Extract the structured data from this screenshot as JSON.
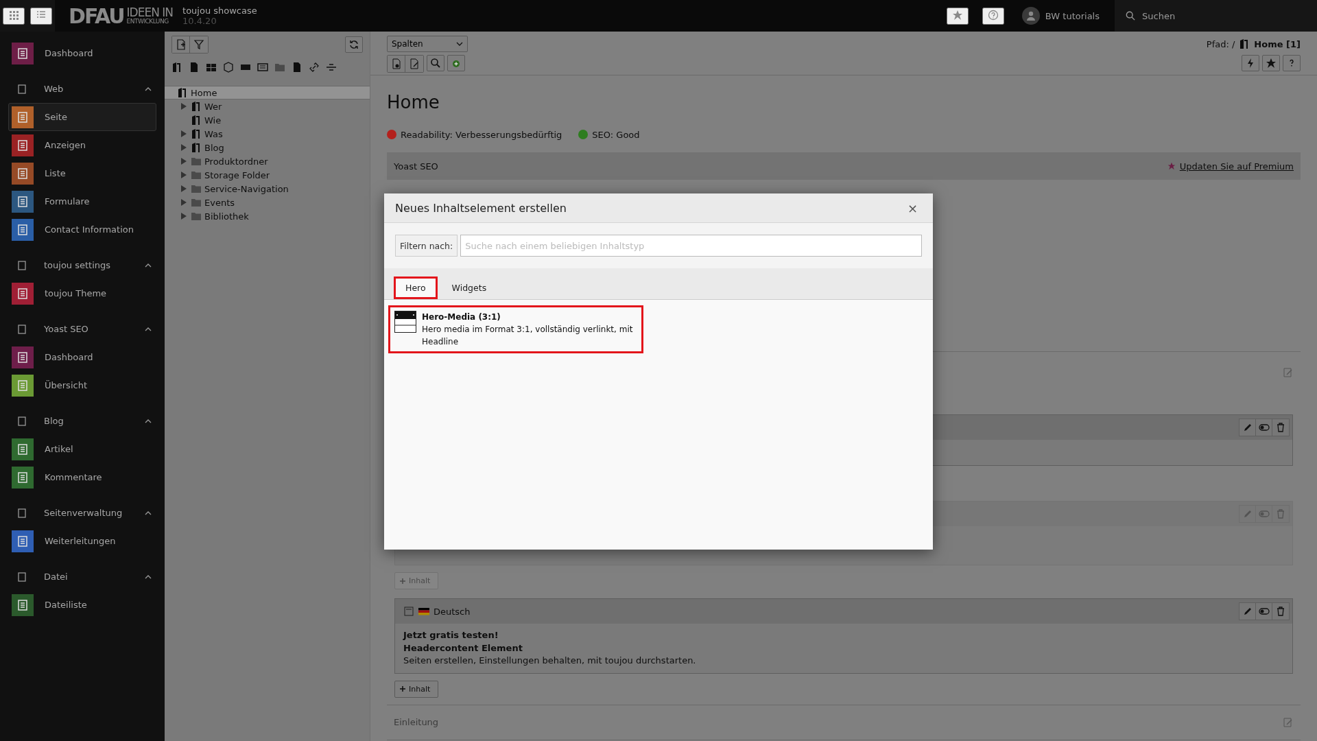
{
  "topbar": {
    "logo_main": "DFAU",
    "logo_top": "IDEEN IN",
    "logo_bottom": "ENTWICKLUNG",
    "site_name": "toujou showcase",
    "version": "10.4.20",
    "user": "BW tutorials",
    "search": "Suchen"
  },
  "sidebar": {
    "dashboard": {
      "label": "Dashboard",
      "color": "#6e1e47",
      "selected": false
    },
    "groups": [
      {
        "label": "Web",
        "expanded": true,
        "items": [
          {
            "label": "Seite",
            "color": "#b0602a",
            "selected": true
          },
          {
            "label": "Anzeigen",
            "color": "#9a2224",
            "selected": false
          },
          {
            "label": "Liste",
            "color": "#964a26",
            "selected": false
          },
          {
            "label": "Formulare",
            "color": "#2c5780",
            "selected": false
          },
          {
            "label": "Contact Information",
            "color": "#2a5ea6",
            "selected": false
          }
        ]
      },
      {
        "label": "toujou settings",
        "expanded": true,
        "items": [
          {
            "label": "toujou Theme",
            "color": "#a01f35",
            "selected": false
          }
        ]
      },
      {
        "label": "Yoast SEO",
        "expanded": true,
        "items": [
          {
            "label": "Dashboard",
            "color": "#6e1e4a",
            "selected": false
          },
          {
            "label": "Übersicht",
            "color": "#6b9a34",
            "selected": false
          }
        ]
      },
      {
        "label": "Blog",
        "expanded": true,
        "items": [
          {
            "label": "Artikel",
            "color": "#2f6a30",
            "selected": false
          },
          {
            "label": "Kommentare",
            "color": "#2f6a30",
            "selected": false
          }
        ]
      },
      {
        "label": "Seitenverwaltung",
        "expanded": true,
        "items": [
          {
            "label": "Weiterleitungen",
            "color": "#2f5eb3",
            "selected": false
          }
        ]
      },
      {
        "label": "Datei",
        "expanded": true,
        "items": [
          {
            "label": "Dateiliste",
            "color": "#2b5a2c",
            "selected": false
          }
        ]
      }
    ]
  },
  "tree": {
    "nodes": [
      {
        "label": "Home",
        "kind": "page",
        "selected": true,
        "collapsible": false,
        "children": [
          {
            "label": "Wer",
            "kind": "page",
            "selected": false,
            "collapsible": true
          },
          {
            "label": "Wie",
            "kind": "page",
            "selected": false,
            "collapsible": false
          },
          {
            "label": "Was",
            "kind": "page",
            "selected": false,
            "collapsible": true
          },
          {
            "label": "Blog",
            "kind": "page",
            "selected": false,
            "collapsible": true
          },
          {
            "label": "Produktordner",
            "kind": "folder",
            "selected": false,
            "collapsible": true
          },
          {
            "label": "Storage Folder",
            "kind": "folder",
            "selected": false,
            "collapsible": true
          },
          {
            "label": "Service-Navigation",
            "kind": "folder",
            "selected": false,
            "collapsible": true
          },
          {
            "label": "Events",
            "kind": "folder",
            "selected": false,
            "collapsible": true
          },
          {
            "label": "Bibliothek",
            "kind": "folder",
            "selected": false,
            "collapsible": true
          }
        ]
      }
    ]
  },
  "docheader": {
    "view_select": "Spalten",
    "path_label": "Pfad: /",
    "path_page": "Home [1]"
  },
  "page": {
    "title": "Home",
    "seo_status": [
      {
        "label": "Readability: Verbesserungsbedürftig",
        "color": "#b3201c"
      },
      {
        "label": "SEO: Good",
        "color": "#2e7d1f"
      }
    ],
    "yoast": {
      "title": "Yoast SEO",
      "premium_link": "Updaten Sie auf Premium"
    },
    "content_elements": [
      {
        "hidden": false
      },
      {
        "hidden": true,
        "add_button": {
          "label": "Inhalt",
          "disabled": true
        }
      },
      {
        "hidden": false,
        "language": "Deutsch",
        "header": "Jetzt gratis testen!",
        "subheader": "Headercontent Element",
        "bodytext": "Seiten erstellen, Einstellungen behalten, mit toujou durchstarten.",
        "add_button": {
          "label": "Inhalt",
          "disabled": false
        }
      }
    ],
    "next_section": "Einleitung"
  },
  "modal": {
    "title": "Neues Inhaltselement erstellen",
    "close": "×",
    "filter_label": "Filtern nach:",
    "placeholder": "Suche nach einem beliebigen Inhaltstyp",
    "tabs": [
      {
        "label": "Hero",
        "selected": true,
        "highlighted": true
      },
      {
        "label": "Widgets",
        "selected": false,
        "highlighted": false
      }
    ],
    "items": [
      {
        "title": "Hero-Media (3:1)",
        "description": "Hero media im Format 3:1, vollständig verlinkt, mit Headline",
        "highlighted": true
      }
    ]
  }
}
